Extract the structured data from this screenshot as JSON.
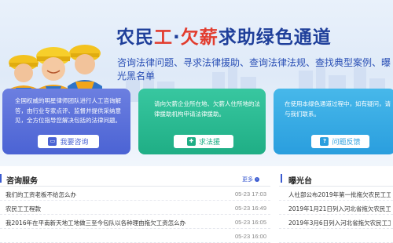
{
  "banner": {
    "title_part1": "农民",
    "title_highlight": "工",
    "title_part2": "·",
    "title_highlight2": "欠薪",
    "title_part3": "求助绿色通道",
    "subtitle": "咨询法律问题、寻求法律援助、查询法律法规、查找典型案例、曝光黑名单"
  },
  "cards": [
    {
      "text": "全国权威的明星律师团队进行人工咨询解答，由行业专家点评、监督并提供采纳意见，全方位指导您解决包括的法律问题。",
      "button_label": "我要咨询",
      "icon": "chat-icon"
    },
    {
      "text": "请向欠薪企业所在地、欠薪人住所地的法律援助机构申请法律援助。",
      "button_label": "求法援",
      "icon": "help-icon"
    },
    {
      "text": "在使用本绿色通道过程中，如有疑问，请与我们联系。",
      "button_label": "问题反馈",
      "icon": "feedback-icon"
    }
  ],
  "consult": {
    "title": "咨询服务",
    "more_label": "更多",
    "rows": [
      {
        "title": "我们的工资老板不给怎么办",
        "date": "05-23 17:03"
      },
      {
        "title": "农民工工程款",
        "date": "05-23 16:49"
      },
      {
        "title": "我2016年在平南新天地工地做三至今包队以各种理由拖欠工资怎么办",
        "date": "05-23 16:05"
      },
      {
        "title": "",
        "date": "05-23 16:00"
      }
    ]
  },
  "exposure": {
    "title": "曝光台",
    "rows": [
      {
        "title": "人社部公布2019年第一批拖欠农民工工资"
      },
      {
        "title": "2019年1月21日列入河北省拖欠农民工工资"
      },
      {
        "title": "2019年3月6日列入河北省拖欠农民工工资"
      },
      {
        "title": ""
      }
    ]
  },
  "colors": {
    "accent": "#3b5bd0",
    "card_blue": "#4b63d4",
    "card_green": "#1fae85",
    "card_cyan": "#2a9ede",
    "title_red": "#e23c2e"
  }
}
